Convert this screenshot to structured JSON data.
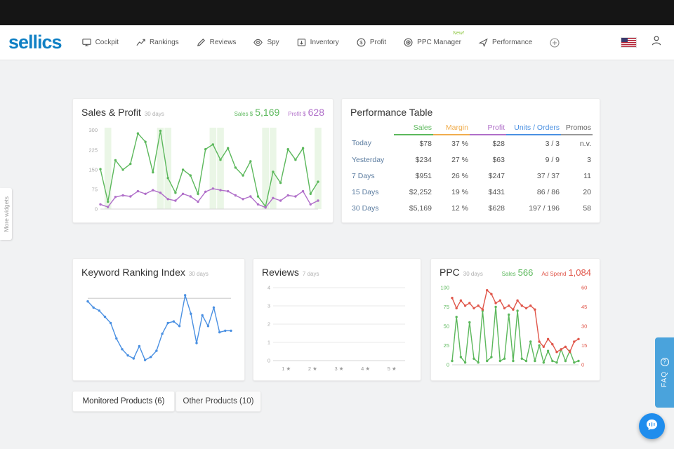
{
  "colors": {
    "brand": "#1080c4",
    "green": "#5cb85c",
    "purple": "#b06fc9",
    "orange": "#f0ad4e",
    "blue": "#4a90e2",
    "red": "#e0564a",
    "faq_bg": "#4aa3dc",
    "chat_bg": "#1f8ded"
  },
  "nav": {
    "logo": "sellics",
    "items": [
      {
        "label": "Cockpit",
        "icon": "monitor-icon"
      },
      {
        "label": "Rankings",
        "icon": "rankings-icon"
      },
      {
        "label": "Reviews",
        "icon": "pencil-icon"
      },
      {
        "label": "Spy",
        "icon": "eye-icon"
      },
      {
        "label": "Inventory",
        "icon": "box-icon"
      },
      {
        "label": "Profit",
        "icon": "dollar-icon"
      },
      {
        "label": "PPC Manager",
        "icon": "target-icon",
        "badge": "New!"
      },
      {
        "label": "Performance",
        "icon": "rocket-icon"
      }
    ]
  },
  "widgets": {
    "sales_profit": {
      "title": "Sales & Profit",
      "subtitle": "30 days",
      "sales_label": "Sales $",
      "sales_value": "5,169",
      "profit_label": "Profit $",
      "profit_value": "628"
    },
    "performance_table": {
      "title": "Performance Table",
      "columns": [
        "Sales",
        "Margin",
        "Profit",
        "Units / Orders",
        "Promos"
      ],
      "rows": [
        {
          "label": "Today",
          "values": [
            "$78",
            "37 %",
            "$28",
            "3 / 3",
            "n.v."
          ]
        },
        {
          "label": "Yesterday",
          "values": [
            "$234",
            "27 %",
            "$63",
            "9 / 9",
            "3"
          ]
        },
        {
          "label": "7 Days",
          "values": [
            "$951",
            "26 %",
            "$247",
            "37 / 37",
            "11"
          ]
        },
        {
          "label": "15 Days",
          "values": [
            "$2,252",
            "19 %",
            "$431",
            "86 / 86",
            "20"
          ]
        },
        {
          "label": "30 Days",
          "values": [
            "$5,169",
            "12 %",
            "$628",
            "197 / 196",
            "58"
          ]
        }
      ]
    },
    "keyword": {
      "title": "Keyword Ranking Index",
      "subtitle": "30 days"
    },
    "reviews": {
      "title": "Reviews",
      "subtitle": "7 days"
    },
    "ppc": {
      "title": "PPC",
      "subtitle": "30 days",
      "sales_label": "Sales",
      "sales_value": "566",
      "adspend_label": "Ad Spend",
      "adspend_value": "1,084"
    }
  },
  "tabs": [
    {
      "label": "Monitored Products (6)"
    },
    {
      "label": "Other Products (10)"
    }
  ],
  "side": {
    "more_widgets": "More widgets",
    "faq": "FAQ",
    "faq_icon": "?"
  },
  "chart_data": [
    {
      "id": "sales-profit-chart",
      "type": "line",
      "title": "Sales & Profit (30 days)",
      "layout": {
        "pl": 28,
        "pr": 10,
        "pt": 8,
        "pb": 10
      },
      "dots": true,
      "baseline": true,
      "band_color": "#d9efd2",
      "bands": [
        1,
        8,
        9,
        15,
        16,
        22,
        23,
        29
      ],
      "axes": [
        {
          "side": "left",
          "lim": [
            0,
            310
          ],
          "ticks": [
            0,
            75,
            150,
            225,
            300
          ],
          "color": "#aaaaaa"
        }
      ],
      "series": [
        {
          "name": "Sales",
          "color": "#5cb85c",
          "axis": 0,
          "values": [
            152,
            28,
            186,
            150,
            172,
            288,
            256,
            140,
            298,
            118,
            62,
            150,
            128,
            58,
            228,
            246,
            188,
            232,
            158,
            128,
            182,
            48,
            10,
            142,
            100,
            228,
            188,
            232,
            58,
            104
          ]
        },
        {
          "name": "Profit",
          "color": "#b06fc9",
          "axis": 0,
          "values": [
            18,
            8,
            46,
            52,
            48,
            68,
            58,
            72,
            62,
            38,
            32,
            58,
            48,
            28,
            66,
            78,
            72,
            68,
            52,
            38,
            48,
            18,
            6,
            42,
            32,
            52,
            48,
            68,
            18,
            32
          ]
        }
      ]
    },
    {
      "id": "keyword-chart",
      "type": "line",
      "title": "Keyword Ranking Index (30 days)",
      "layout": {
        "pl": 12,
        "pr": 10,
        "pt": 10,
        "pb": 8
      },
      "dots": true,
      "ref_line": {
        "value": 88,
        "axis": 0,
        "color": "#cccccc"
      },
      "axes": [
        {
          "side": "left",
          "lim": [
            0,
            100
          ],
          "ticks": [],
          "color": "#aaaaaa"
        }
      ],
      "series": [
        {
          "name": "Keyword Ranking Index",
          "color": "#4a90e2",
          "axis": 0,
          "values": [
            84,
            76,
            72,
            64,
            56,
            36,
            22,
            14,
            10,
            26,
            8,
            12,
            20,
            42,
            56,
            58,
            52,
            92,
            68,
            30,
            66,
            52,
            76,
            44,
            46,
            46
          ]
        }
      ]
    },
    {
      "id": "reviews-chart",
      "type": "line",
      "title": "Reviews (7 days)",
      "layout": {
        "pl": 18,
        "pr": 12,
        "pt": 8,
        "pb": 18
      },
      "grid": true,
      "baseline": true,
      "x_labels": [
        "1 ★",
        "2 ★",
        "3 ★",
        "4 ★",
        "5 ★"
      ],
      "axes": [
        {
          "side": "left",
          "lim": [
            0,
            4
          ],
          "ticks": [
            0,
            1,
            2,
            3,
            4
          ],
          "color": "#aaaaaa"
        }
      ],
      "series": []
    },
    {
      "id": "ppc-chart",
      "type": "line",
      "title": "PPC (30 days)",
      "layout": {
        "pl": 22,
        "pr": 22,
        "pt": 8,
        "pb": 10
      },
      "dots": true,
      "baseline": true,
      "axes": [
        {
          "side": "left",
          "lim": [
            0,
            100
          ],
          "ticks": [
            0,
            25,
            50,
            75,
            100
          ],
          "color": "#5cb85c"
        },
        {
          "side": "right",
          "lim": [
            0,
            60
          ],
          "ticks": [
            0,
            15,
            30,
            45,
            60
          ],
          "color": "#e0564a"
        }
      ],
      "series": [
        {
          "name": "Sales",
          "color": "#5cb85c",
          "axis": 0,
          "values": [
            5,
            62,
            10,
            3,
            55,
            8,
            3,
            70,
            5,
            10,
            75,
            5,
            8,
            65,
            5,
            70,
            8,
            5,
            30,
            5,
            25,
            3,
            18,
            5,
            3,
            20,
            5,
            18,
            3,
            5
          ]
        },
        {
          "name": "Ad Spend",
          "color": "#e0564a",
          "axis": 1,
          "values": [
            52,
            44,
            50,
            46,
            48,
            44,
            46,
            43,
            58,
            55,
            48,
            50,
            44,
            46,
            43,
            50,
            46,
            44,
            46,
            43,
            18,
            14,
            20,
            16,
            10,
            12,
            14,
            10,
            18,
            20
          ]
        }
      ]
    }
  ]
}
